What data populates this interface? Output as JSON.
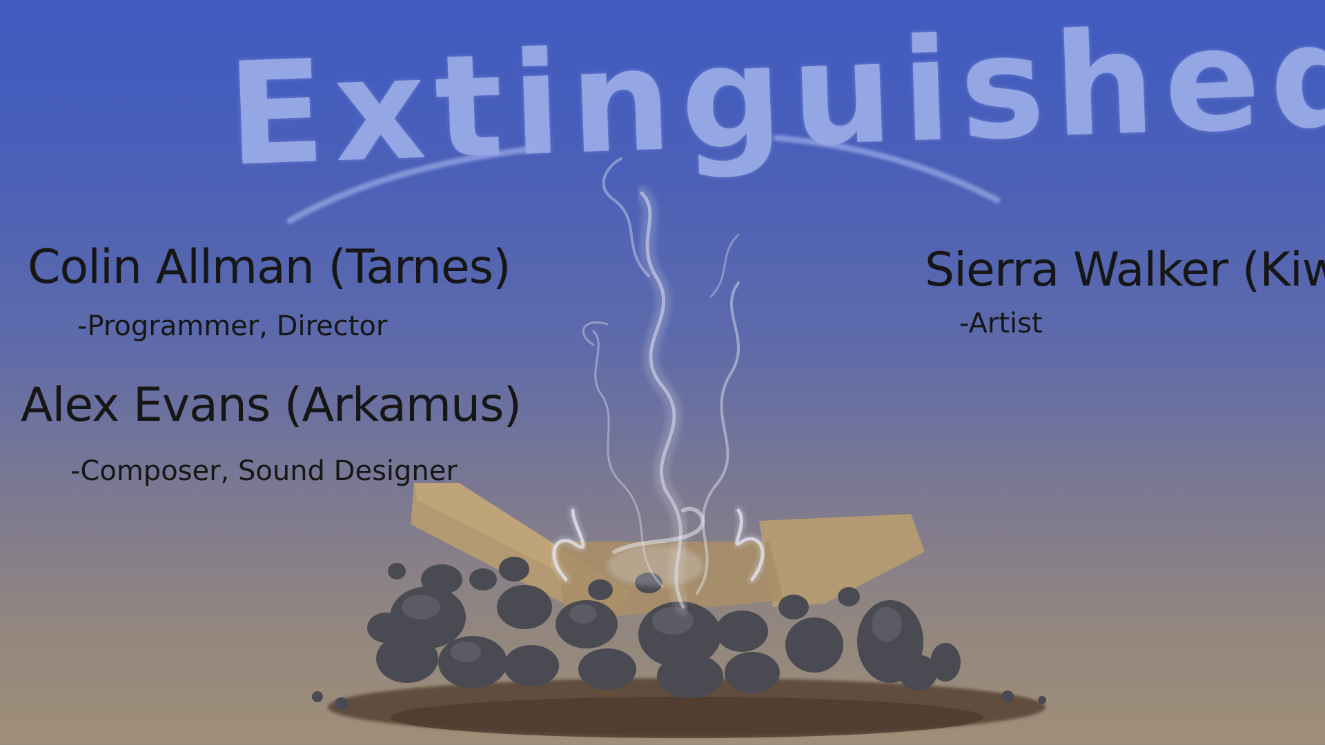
{
  "title": "Extinguished",
  "credits": [
    {
      "name": "Colin Allman (Tarnes)",
      "role": "-Programmer, Director"
    },
    {
      "name": "Alex Evans (Arkamus)",
      "role": "-Composer, Sound Designer"
    },
    {
      "name": "Sierra Walker (Kiwi)",
      "role": "-Artist"
    }
  ],
  "colors": {
    "sky_top": "#3f5bc0",
    "sky_bottom": "#a08e78",
    "title": "#9aaae8",
    "text": "#161616",
    "log": "#b39a72",
    "rock": "#4a4a52",
    "dirt": "#5a4637",
    "smoke": "#e8eaf4"
  }
}
